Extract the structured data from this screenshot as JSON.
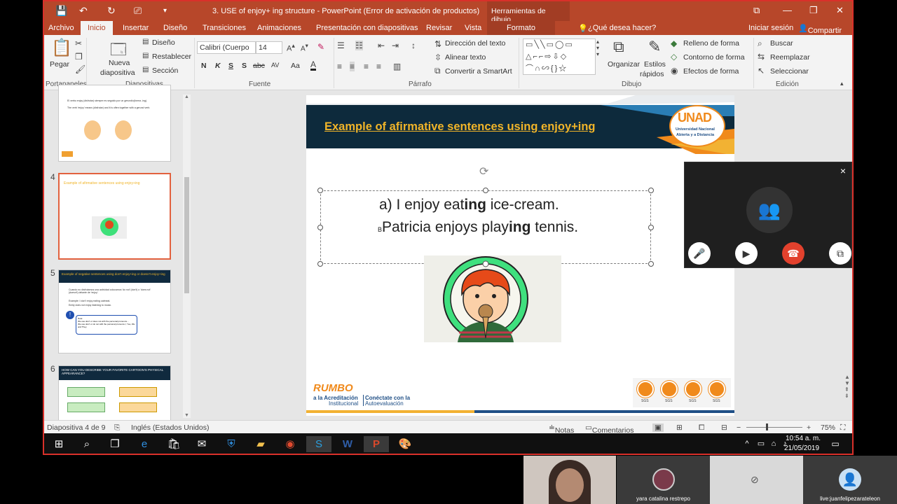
{
  "window": {
    "title": "3. USE of enjoy+ ing structure - PowerPoint (Error de activación de productos)",
    "context_tab": "Herramientas de dibujo",
    "minimize": "⧉",
    "restore": "—",
    "maximize": "❐",
    "close": "✕"
  },
  "tabs": [
    "Archivo",
    "Inicio",
    "Insertar",
    "Diseño",
    "Transiciones",
    "Animaciones",
    "Presentación con diapositivas",
    "Revisar",
    "Vista",
    "Formato"
  ],
  "tell_me": "¿Qué desea hacer?",
  "account": {
    "signin": "Iniciar sesión",
    "share": "Compartir"
  },
  "ribbon": {
    "clipboard": {
      "paste": "Pegar",
      "group": "Portapapeles"
    },
    "slides": {
      "new_slide_1": "Nueva",
      "new_slide_2": "diapositiva",
      "layout": "Diseño",
      "reset": "Restablecer",
      "section": "Sección",
      "group": "Diapositivas"
    },
    "font": {
      "name": "Calibri (Cuerpo",
      "size": "14",
      "bold": "N",
      "italic": "K",
      "underline": "S",
      "shadow": "S",
      "strike": "abc",
      "spacing": "AV",
      "case": "Aa",
      "group": "Fuente"
    },
    "paragraph": {
      "text_direction": "Dirección del texto",
      "align_text": "Alinear texto",
      "smartart": "Convertir a SmartArt",
      "group": "Párrafo"
    },
    "drawing": {
      "arrange": "Organizar",
      "quick_styles_1": "Estilos",
      "quick_styles_2": "rápidos",
      "fill": "Relleno de forma",
      "outline": "Contorno de forma",
      "effects": "Efectos de forma",
      "group": "Dibujo"
    },
    "editing": {
      "find": "Buscar",
      "replace": "Reemplazar",
      "select": "Seleccionar",
      "group": "Edición"
    }
  },
  "thumbnails": [
    {
      "number": "",
      "lines": [
        "El verbo enjoy (disfrutar) siempre es seguido por un gerundio(forma -ing).",
        "The verb 'enjoy' means (disfrutar) and it is often together with a gerund verb."
      ]
    },
    {
      "number": "4",
      "title": "Example of afirmative sentences using enjoy+ing"
    },
    {
      "number": "5",
      "title": "Example of negative sentences using don't enjoy+ing or doesn't enjoy+ing",
      "lines": [
        "Cuando no disfrutamos una actividad colocamos 'do not' (don't) o 'does not' (doesn't) delante de 'enjoy'.",
        "Example: I don't enjoy eating oatmeal.",
        "Emily does not enjoy listening to music.",
        "Note:",
        "We use don't or does not with the personal pronouns...",
        "We use don't or do not with the personal pronouns I, You, We and They."
      ]
    },
    {
      "number": "6",
      "title": "HOW CAN YOU DESCRIBE YOUR FAVORITE CARTOON'S PHYSICAL APPEARANCE?"
    }
  ],
  "slide": {
    "title": "Example of afirmative sentences using enjoy+ing",
    "logo_big": "UNAD",
    "logo_line1": "Universidad Nacional",
    "logo_line2": "Abierta y a Distancia",
    "line_a_prefix": "a) I enjoy eat",
    "line_a_bold": "ing",
    "line_a_suffix": " ice-cream.",
    "line_b_marker": "B",
    "line_b_prefix": "Patricia enjoys play",
    "line_b_bold": "ing",
    "line_b_suffix": " tennis.",
    "footer_rumbo": "RUMBO",
    "footer_acred_1": "a la Acreditación",
    "footer_acred_2": "Institucional",
    "footer_conect_1": "Conéctate con la",
    "footer_conect_2": "Autoevaluación",
    "sgs": "SGS"
  },
  "statusbar": {
    "slide": "Diapositiva 4 de 9",
    "language": "Inglés (Estados Unidos)",
    "notes": "Notas",
    "comments": "Comentarios",
    "zoom": "75%"
  },
  "taskbar": {
    "time": "10:54 a. m.",
    "date": "21/05/2019"
  },
  "call": {
    "close": "×"
  },
  "participants": [
    {
      "name": "yara catalina restrepo"
    },
    {
      "name": "live:juanfelipezarateleon"
    }
  ],
  "colors": {
    "accent": "#b7472a",
    "slide_title": "#f0b429",
    "selection": "#e2613e",
    "hangup": "#e2412d"
  }
}
